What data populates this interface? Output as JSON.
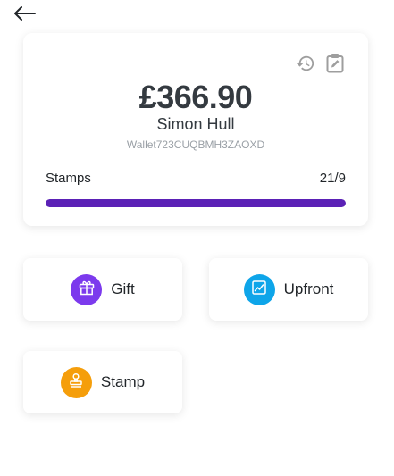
{
  "wallet": {
    "balance": "£366.90",
    "holder_name": "Simon Hull",
    "wallet_id": "Wallet723CUQBMH3ZAOXD",
    "stamps_label": "Stamps",
    "stamps_value": "21/9",
    "stamps_progress": 1.0
  },
  "actions": [
    {
      "label": "Gift",
      "icon": "gift-icon",
      "color": "#7c3aed"
    },
    {
      "label": "Upfront",
      "icon": "chart-line-icon",
      "color": "#0ea5e9"
    },
    {
      "label": "Stamp",
      "icon": "stamp-icon",
      "color": "#f59e0b"
    }
  ],
  "colors": {
    "accent": "#5b21b6",
    "text_dark": "#343a40",
    "muted": "#9aa0a6"
  }
}
